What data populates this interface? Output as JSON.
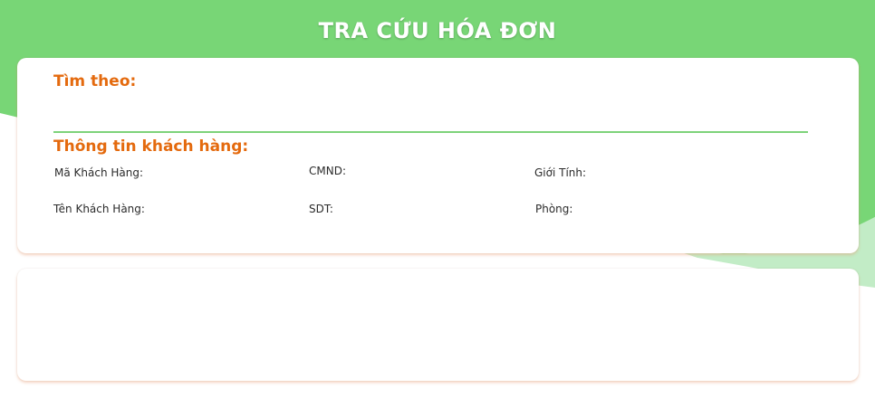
{
  "header": {
    "title": "TRA CỨU HÓA ĐƠN"
  },
  "colors": {
    "header_green": "#78d676",
    "accent_orange": "#e46a0e",
    "divider_green": "#7dd37a"
  },
  "search": {
    "heading": "Tìm theo:",
    "value": ""
  },
  "customer_info": {
    "heading": "Thông tin khách hàng:",
    "fields": {
      "customer_id": {
        "label": "Mã Khách Hàng:",
        "value": ""
      },
      "id_card": {
        "label": "CMND:",
        "value": ""
      },
      "gender": {
        "label": "Giới Tính:",
        "value": ""
      },
      "customer_name": {
        "label": "Tên Khách Hàng:",
        "value": ""
      },
      "phone": {
        "label": "SDT:",
        "value": ""
      },
      "room": {
        "label": "Phòng:",
        "value": ""
      }
    }
  },
  "results": {}
}
